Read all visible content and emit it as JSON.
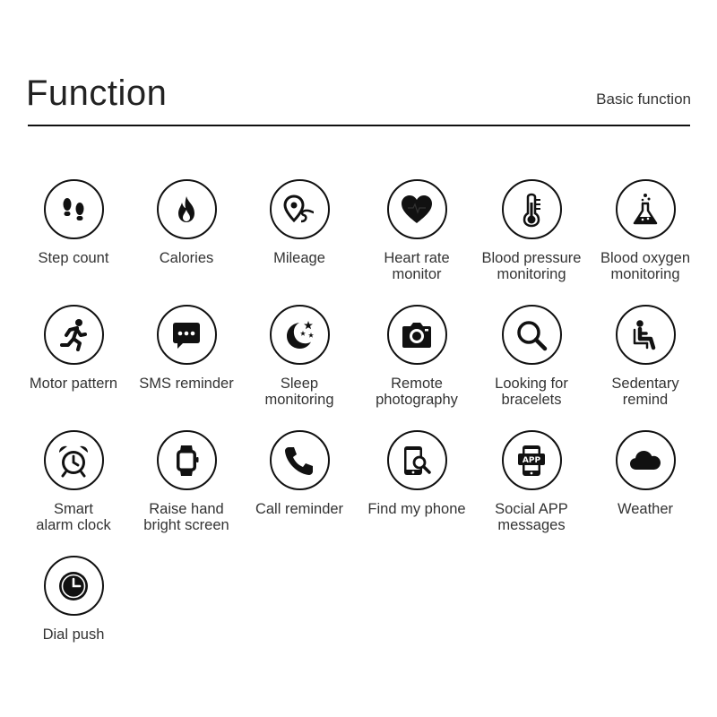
{
  "header": {
    "title": "Function",
    "subtitle": "Basic function"
  },
  "features": [
    {
      "label": "Step count",
      "icon": "footprints-icon"
    },
    {
      "label": "Calories",
      "icon": "flame-icon"
    },
    {
      "label": "Mileage",
      "icon": "map-pin-route-icon"
    },
    {
      "label": "Heart rate\nmonitor",
      "icon": "heart-icon"
    },
    {
      "label": "Blood pressure\nmonitoring",
      "icon": "thermometer-icon"
    },
    {
      "label": "Blood oxygen\nmonitoring",
      "icon": "flask-icon"
    },
    {
      "label": "Motor pattern",
      "icon": "runner-icon"
    },
    {
      "label": "SMS reminder",
      "icon": "message-bubble-icon"
    },
    {
      "label": "Sleep\nmonitoring",
      "icon": "moon-stars-icon"
    },
    {
      "label": "Remote\nphotography",
      "icon": "camera-icon"
    },
    {
      "label": "Looking for\nbracelets",
      "icon": "magnifier-icon"
    },
    {
      "label": "Sedentary\nremind",
      "icon": "seated-person-icon"
    },
    {
      "label": "Smart\nalarm clock",
      "icon": "alarm-clock-icon"
    },
    {
      "label": "Raise hand\nbright screen",
      "icon": "smartwatch-icon"
    },
    {
      "label": "Call reminder",
      "icon": "phone-handset-icon"
    },
    {
      "label": "Find my phone",
      "icon": "phone-search-icon"
    },
    {
      "label": "Social APP\nmessages",
      "icon": "app-phone-icon",
      "icon_text": "APP"
    },
    {
      "label": "Weather",
      "icon": "cloud-icon"
    },
    {
      "label": "Dial push",
      "icon": "clock-dial-icon"
    }
  ]
}
